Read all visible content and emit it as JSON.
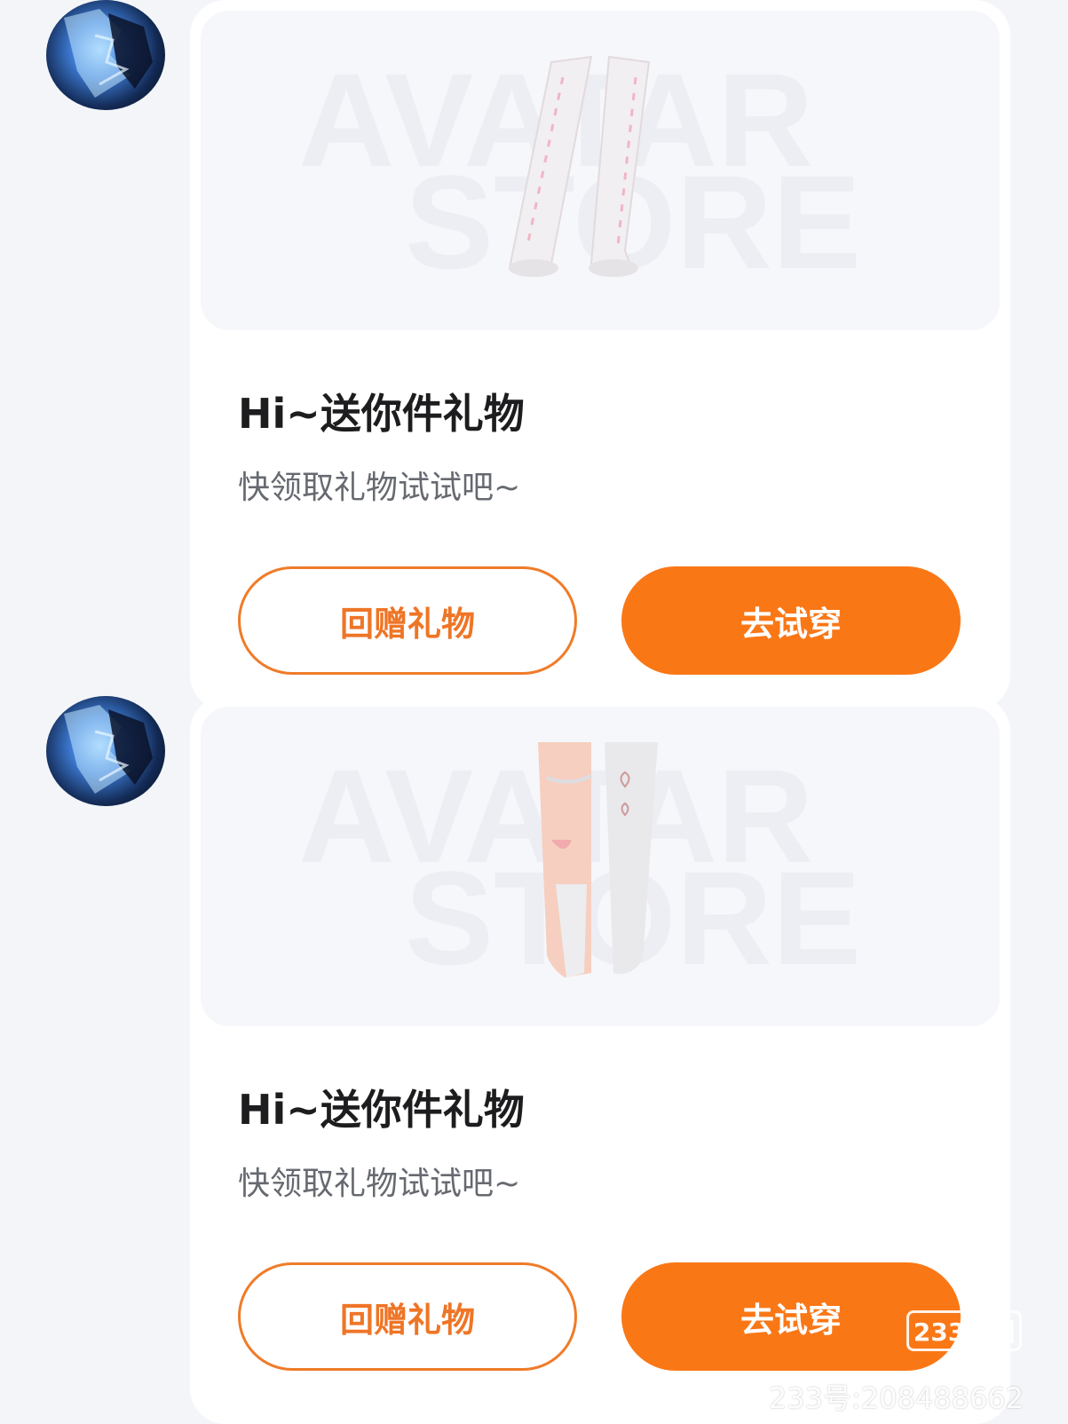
{
  "messages": [
    {
      "avatar_icon": "user-avatar-icon",
      "preview_watermark": [
        "AVATAR",
        "STORE"
      ],
      "item_icon": "long-white-boots-icon",
      "title": "Hi~送你件礼物",
      "subtitle": "快领取礼物试试吧~",
      "return_gift_label": "回赠礼物",
      "try_on_label": "去试穿"
    },
    {
      "avatar_icon": "user-avatar-icon",
      "preview_watermark": [
        "AVATAR",
        "STORE"
      ],
      "item_icon": "heart-stockings-icon",
      "title": "Hi~送你件礼物",
      "subtitle": "快领取礼物试试吧~",
      "return_gift_label": "回赠礼物",
      "try_on_label": "去试穿"
    }
  ],
  "watermark": {
    "brand": "233乐园",
    "id_text": "233号:208488662"
  },
  "colors": {
    "accent": "#fa7716",
    "outline": "#f07b29",
    "background": "#f3f5f9"
  }
}
